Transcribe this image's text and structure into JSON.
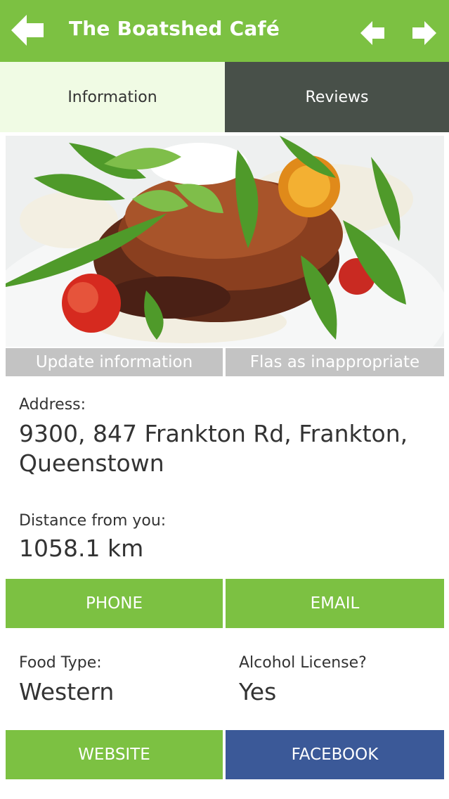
{
  "header": {
    "title": "The Boatshed Café",
    "back_icon": "arrow-left-icon",
    "prev_icon": "arrow-left-icon",
    "next_icon": "arrow-right-icon",
    "background": "#7cc142"
  },
  "tabs": [
    {
      "label": "Information",
      "active": true
    },
    {
      "label": "Reviews",
      "active": false
    }
  ],
  "actions": {
    "update": "Update information",
    "flag": "Flas as inappropriate"
  },
  "details": {
    "address_label": "Address:",
    "address_line1": "9300, 847 Frankton Rd, Frankton,",
    "address_line2": "Queenstown",
    "distance_label": "Distance from you:",
    "distance_value": "1058.1 km",
    "food_label": "Food Type:",
    "food_value": "Western",
    "alcohol_label": "Alcohol License?",
    "alcohol_value": "Yes"
  },
  "buttons": {
    "phone": "PHONE",
    "email": "EMAIL",
    "website": "WEBSITE",
    "facebook": "FACEBOOK"
  },
  "colors": {
    "accent": "#7cc142",
    "dark_tab": "#485049",
    "facebook": "#3b5998",
    "secondary_button": "#c3c3c3"
  }
}
